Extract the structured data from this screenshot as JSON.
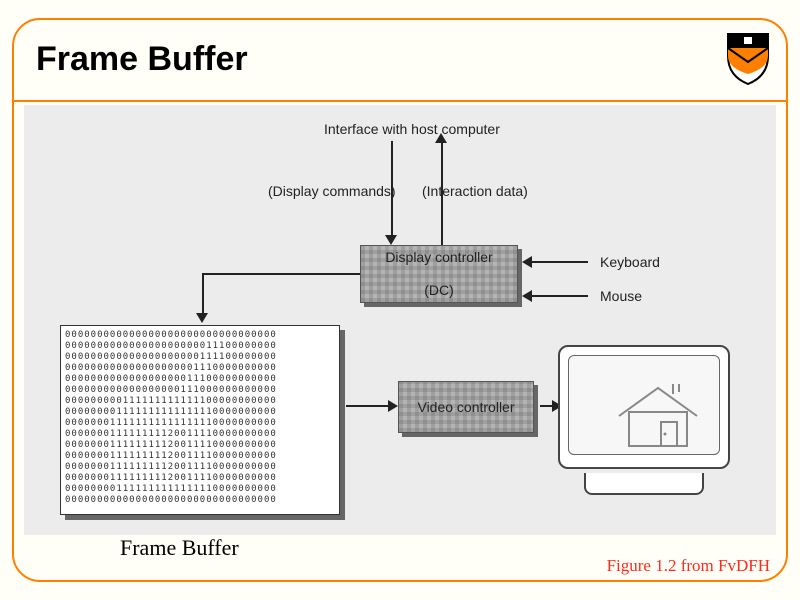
{
  "title": "Frame Buffer",
  "caption": "Figure 1.2 from FvDFH",
  "framebuffer_label": "Frame Buffer",
  "labels": {
    "interface": "Interface with host computer",
    "display_commands": "(Display commands)",
    "interaction_data": "(Interaction data)",
    "keyboard": "Keyboard",
    "mouse": "Mouse"
  },
  "boxes": {
    "display_controller_line1": "Display controller",
    "display_controller_line2": "(DC)",
    "video_controller": "Video controller"
  },
  "framebuffer_bits": "000000000000000000000000000000000\n000000000000000000000011100000000\n000000000000000000000111100000000\n000000000000000000001110000000000\n000000000000000000011100000000000\n000000000000000000111000000000000\n000000000111111111111100000000000\n000000001111111111111110000000000\n000000011111111111111110000000000\n000000011111111120011110000000000\n000000011111111120011110000000000\n000000011111111120011110000000000\n000000011111111120011110000000000\n000000011111111120011110000000000\n000000001111111111111110000000000\n000000000000000000000000000000000"
}
